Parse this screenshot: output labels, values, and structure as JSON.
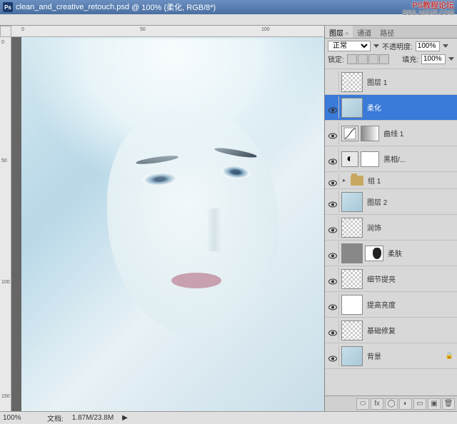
{
  "titlebar": {
    "filename": "clean_and_creative_retouch.psd",
    "zoom_title": "@ 100% (柔化, RGB/8*)"
  },
  "watermark": {
    "line1": "PS教程论坛",
    "line2": "BBS.16XX8.COM"
  },
  "ruler_h": {
    "m0": "0",
    "m1": "50",
    "m2": "100"
  },
  "ruler_v": {
    "m0": "0",
    "m1": "50",
    "m2": "100",
    "m3": "150"
  },
  "statusbar": {
    "zoom": "100%",
    "docsize_label": "文档:",
    "docsize": "1.87M/23.8M"
  },
  "panel": {
    "tabs": {
      "layers": "图层",
      "channels": "通道",
      "paths": "路径"
    },
    "blend_label": "正常",
    "opacity_label": "不透明度:",
    "opacity_value": "100%",
    "lock_label": "锁定:",
    "fill_label": "填充:",
    "fill_value": "100%"
  },
  "layers": [
    {
      "name": "图层 1",
      "thumb": "checker",
      "vis": false
    },
    {
      "name": "柔化",
      "thumb": "portrait-thumb",
      "vis": true,
      "selected": true
    },
    {
      "name": "曲线 1",
      "thumb": "curves",
      "mask": "grad",
      "vis": true,
      "adj": true
    },
    {
      "name": "黑相/...",
      "thumb": "adj",
      "mask": "white",
      "vis": true,
      "adj": true
    },
    {
      "name": "组 1",
      "type": "group",
      "vis": true
    },
    {
      "name": "图层 2",
      "thumb": "portrait-thumb",
      "vis": true
    },
    {
      "name": "润饰",
      "thumb": "checker",
      "vis": true
    },
    {
      "name": "柔肤",
      "thumb": "gray",
      "mask": "bw",
      "vis": true
    },
    {
      "name": "细节提亮",
      "thumb": "checker",
      "vis": true
    },
    {
      "name": "提高亮度",
      "thumb": "white",
      "vis": true
    },
    {
      "name": "基础修复",
      "thumb": "checker",
      "vis": true
    },
    {
      "name": "背景",
      "thumb": "portrait-thumb",
      "vis": true,
      "locked": true
    }
  ]
}
